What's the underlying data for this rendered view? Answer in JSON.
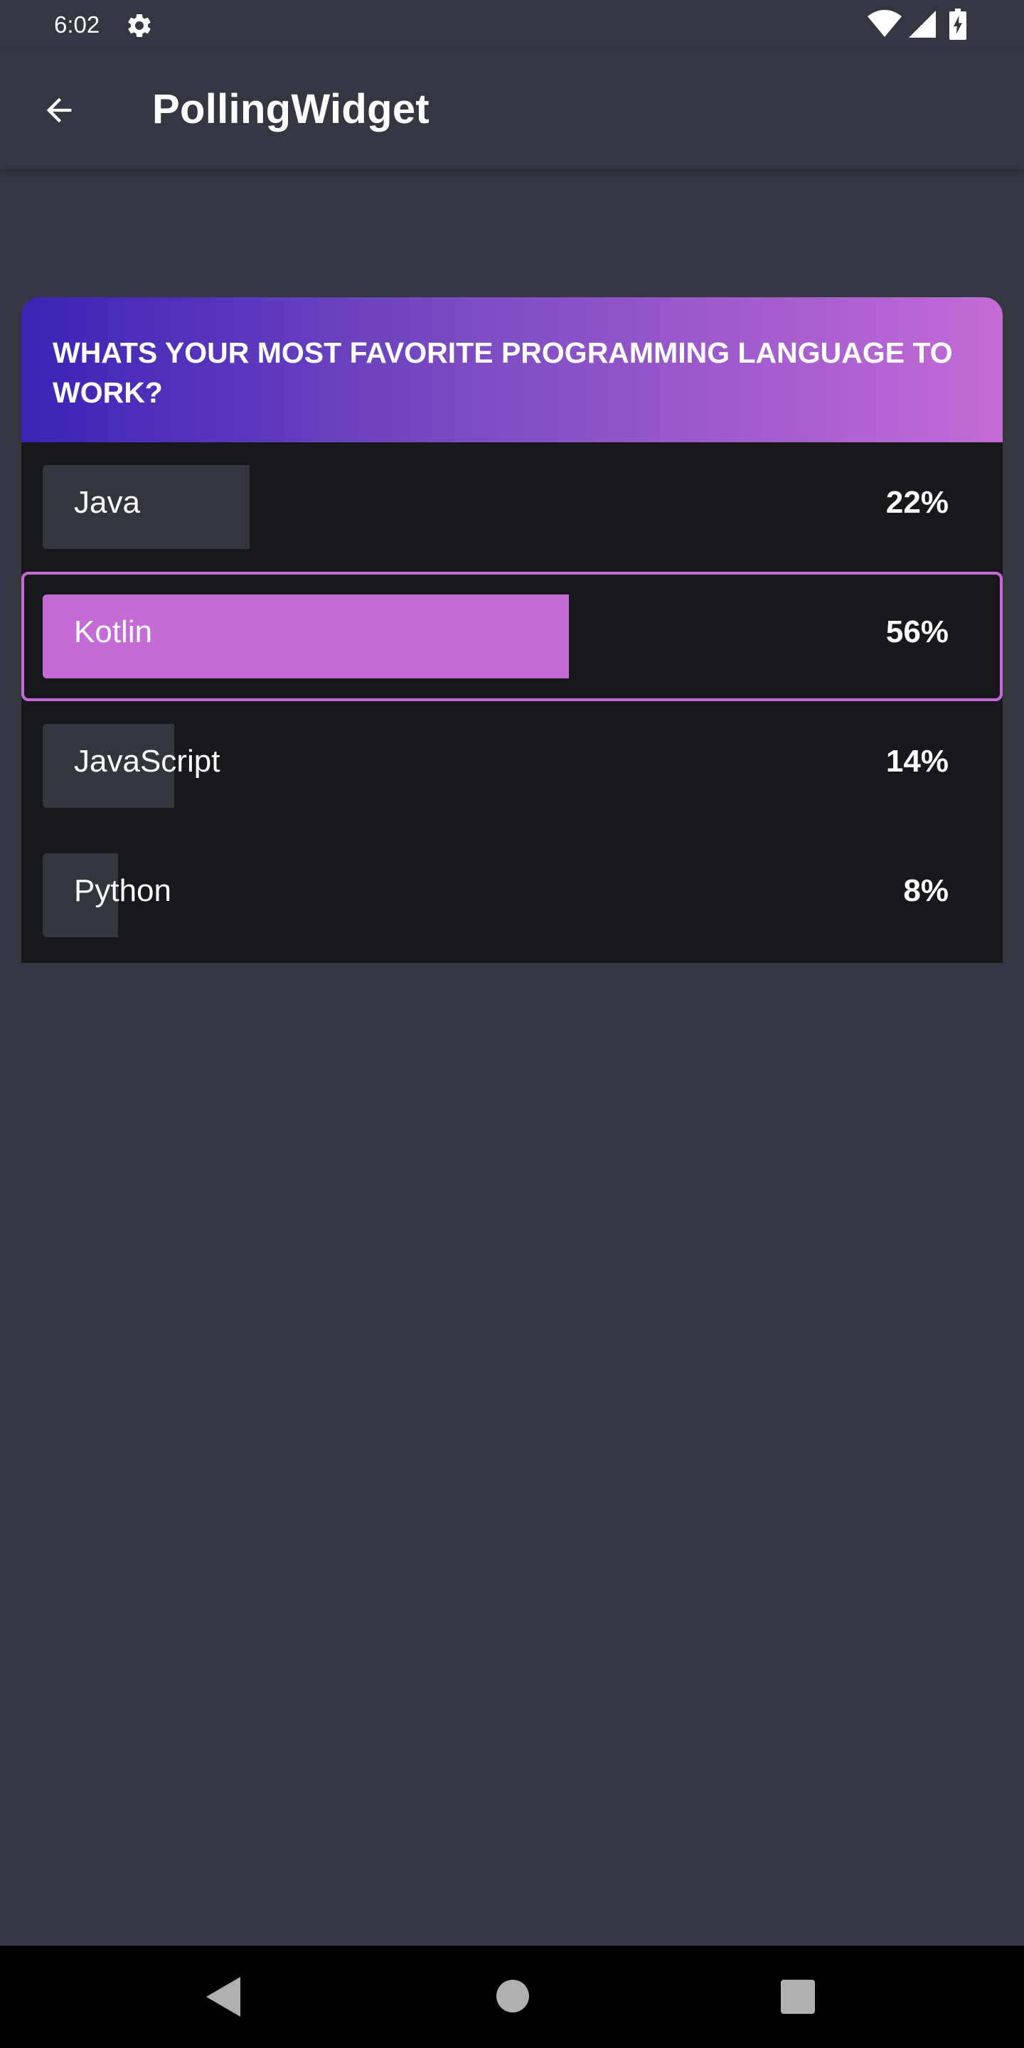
{
  "status_bar": {
    "time": "6:02",
    "icons": [
      "gear-icon",
      "wifi-icon",
      "signal-icon",
      "battery-charging-icon"
    ]
  },
  "app_bar": {
    "title": "PollingWidget",
    "back_icon": "arrow-back-icon"
  },
  "poll": {
    "question": "WHATS YOUR MOST FAVORITE PROGRAMMING LANGUAGE TO WORK?",
    "header_gradient": [
      "#3b23b5",
      "#c46bd6"
    ],
    "accent_color": "#c46bd6",
    "options": [
      {
        "label": "Java",
        "percent_text": "22%",
        "percent": 22,
        "selected": false
      },
      {
        "label": "Kotlin",
        "percent_text": "56%",
        "percent": 56,
        "selected": true
      },
      {
        "label": "JavaScript",
        "percent_text": "14%",
        "percent": 14,
        "selected": false
      },
      {
        "label": "Python",
        "percent_text": "8%",
        "percent": 8,
        "selected": false
      }
    ]
  },
  "nav_bar": {
    "icons": [
      "nav-back-icon",
      "nav-home-icon",
      "nav-recents-icon"
    ]
  },
  "colors": {
    "background": "#343741",
    "poll_body": "#17181c",
    "unselected_fill": "#33363d",
    "nav_bar": "#000000"
  }
}
